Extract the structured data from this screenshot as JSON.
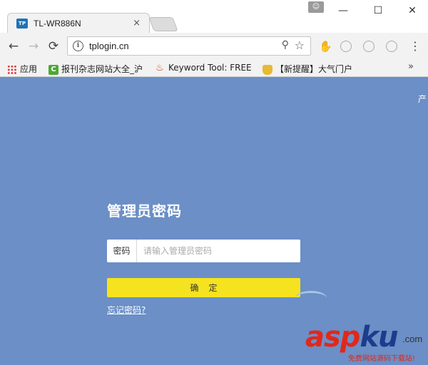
{
  "window": {
    "tab_title": "TL-WR886N",
    "tab_favicon_text": "TP",
    "tab_close_glyph": "×",
    "profile_glyph": "☺",
    "minimize_glyph": "—",
    "maximize_glyph": "☐",
    "close_glyph": "✕"
  },
  "toolbar": {
    "back_glyph": "←",
    "forward_glyph": "→",
    "reload_glyph": "⟳",
    "url": "tplogin.cn",
    "info_glyph": "i",
    "zoom_glyph": "⚲",
    "star_glyph": "☆",
    "menu_glyph": "⋮",
    "ext1_glyph": "✋"
  },
  "bookmarks": {
    "apps_label": "应用",
    "items": [
      {
        "label": "报刊杂志网站大全_沪"
      },
      {
        "label": "Keyword Tool: FREE"
      },
      {
        "label": "【新提醒】大气门户"
      }
    ],
    "more_glyph": "»"
  },
  "page": {
    "corner_text": "产",
    "heading": "管理员密码",
    "password_label": "密码",
    "password_placeholder": "请输入管理员密码",
    "password_value": "",
    "confirm_label": "确定",
    "forgot_link": "忘记密码?"
  },
  "watermark": {
    "brand_asp": "asp",
    "brand_ku": "ku",
    "brand_dotcom": ".com",
    "tagline": "免费网站源码下载站!"
  },
  "colors": {
    "page_background": "#6b8fc6",
    "confirm_button": "#f6e31f",
    "favicon": "#1f73b7"
  }
}
